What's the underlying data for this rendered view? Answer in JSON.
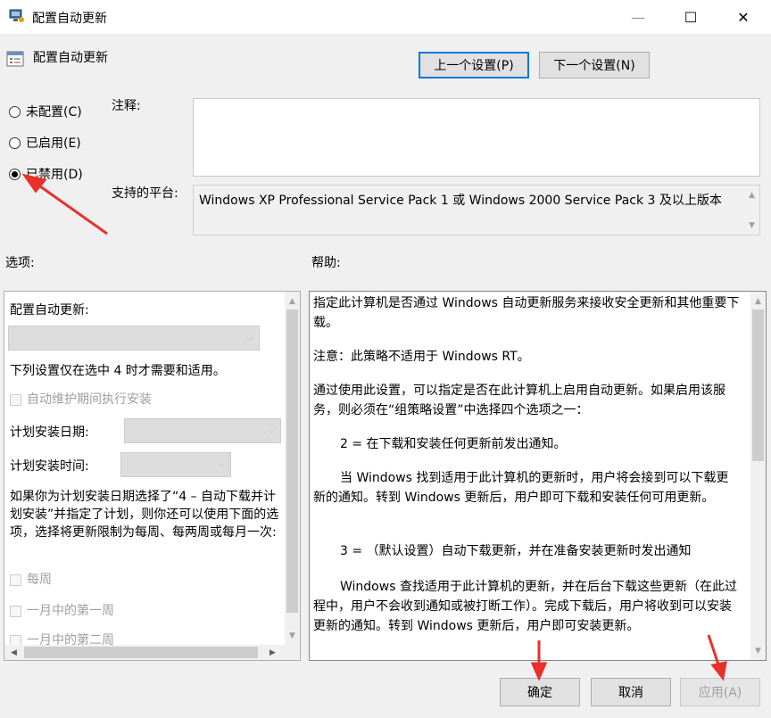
{
  "window": {
    "title": "配置自动更新",
    "controls": {
      "minimize": "—",
      "maximize": "☐",
      "close": "✕"
    }
  },
  "header": {
    "policy_title": "配置自动更新",
    "prev_button": "上一个设置(P)",
    "next_button": "下一个设置(N)"
  },
  "state_radios": [
    {
      "label": "未配置(C)",
      "checked": false
    },
    {
      "label": "已启用(E)",
      "checked": false
    },
    {
      "label": "已禁用(D)",
      "checked": true
    }
  ],
  "comment": {
    "label": "注释:",
    "value": ""
  },
  "platform": {
    "label": "支持的平台:",
    "value": "Windows XP Professional Service Pack 1 或 Windows 2000 Service Pack 3 及以上版本"
  },
  "options": {
    "label": "选项:",
    "configure_label": "配置自动更新:",
    "note": "下列设置仅在选中 4 时才需要和适用。",
    "maintenance_checkbox": "自动维护期间执行安装",
    "install_day_label": "计划安装日期:",
    "install_time_label": "计划安装时间:",
    "schedule_note": "如果你为计划安装日期选择了“4 – 自动下载并计划安装”并指定了计划，则你还可以使用下面的选项，选择将更新限制为每周、每两周或每月一次:",
    "weekly_checkbox": "每周",
    "first_week_checkbox": "一月中的第一周",
    "second_week_checkbox": "一月中的第二周"
  },
  "help": {
    "label": "帮助:",
    "paragraphs": [
      "指定此计算机是否通过 Windows 自动更新服务来接收安全更新和其他重要下载。",
      "注意：此策略不适用于 Windows RT。",
      "通过使用此设置，可以指定是否在此计算机上启用自动更新。如果启用该服务，则必须在“组策略设置”中选择四个选项之一：",
      "2 = 在下载和安装任何更新前发出通知。",
      "当 Windows 找到适用于此计算机的更新时，用户将会接到可以下载更新的通知。转到 Windows 更新后，用户即可下载和安装任何可用更新。",
      "3 = （默认设置）自动下载更新，并在准备安装更新时发出通知",
      "Windows 查找适用于此计算机的更新，并在后台下载这些更新（在此过程中，用户不会收到通知或被打断工作）。完成下载后，用户将收到可以安装更新的通知。转到 Windows 更新后，用户即可安装更新。"
    ]
  },
  "footer": {
    "ok": "确定",
    "cancel": "取消",
    "apply": "应用(A)"
  },
  "colors": {
    "annotation_arrow": "#e8312a",
    "focus_blue": "#0078d7",
    "disabled_text": "#a0a0a0"
  }
}
